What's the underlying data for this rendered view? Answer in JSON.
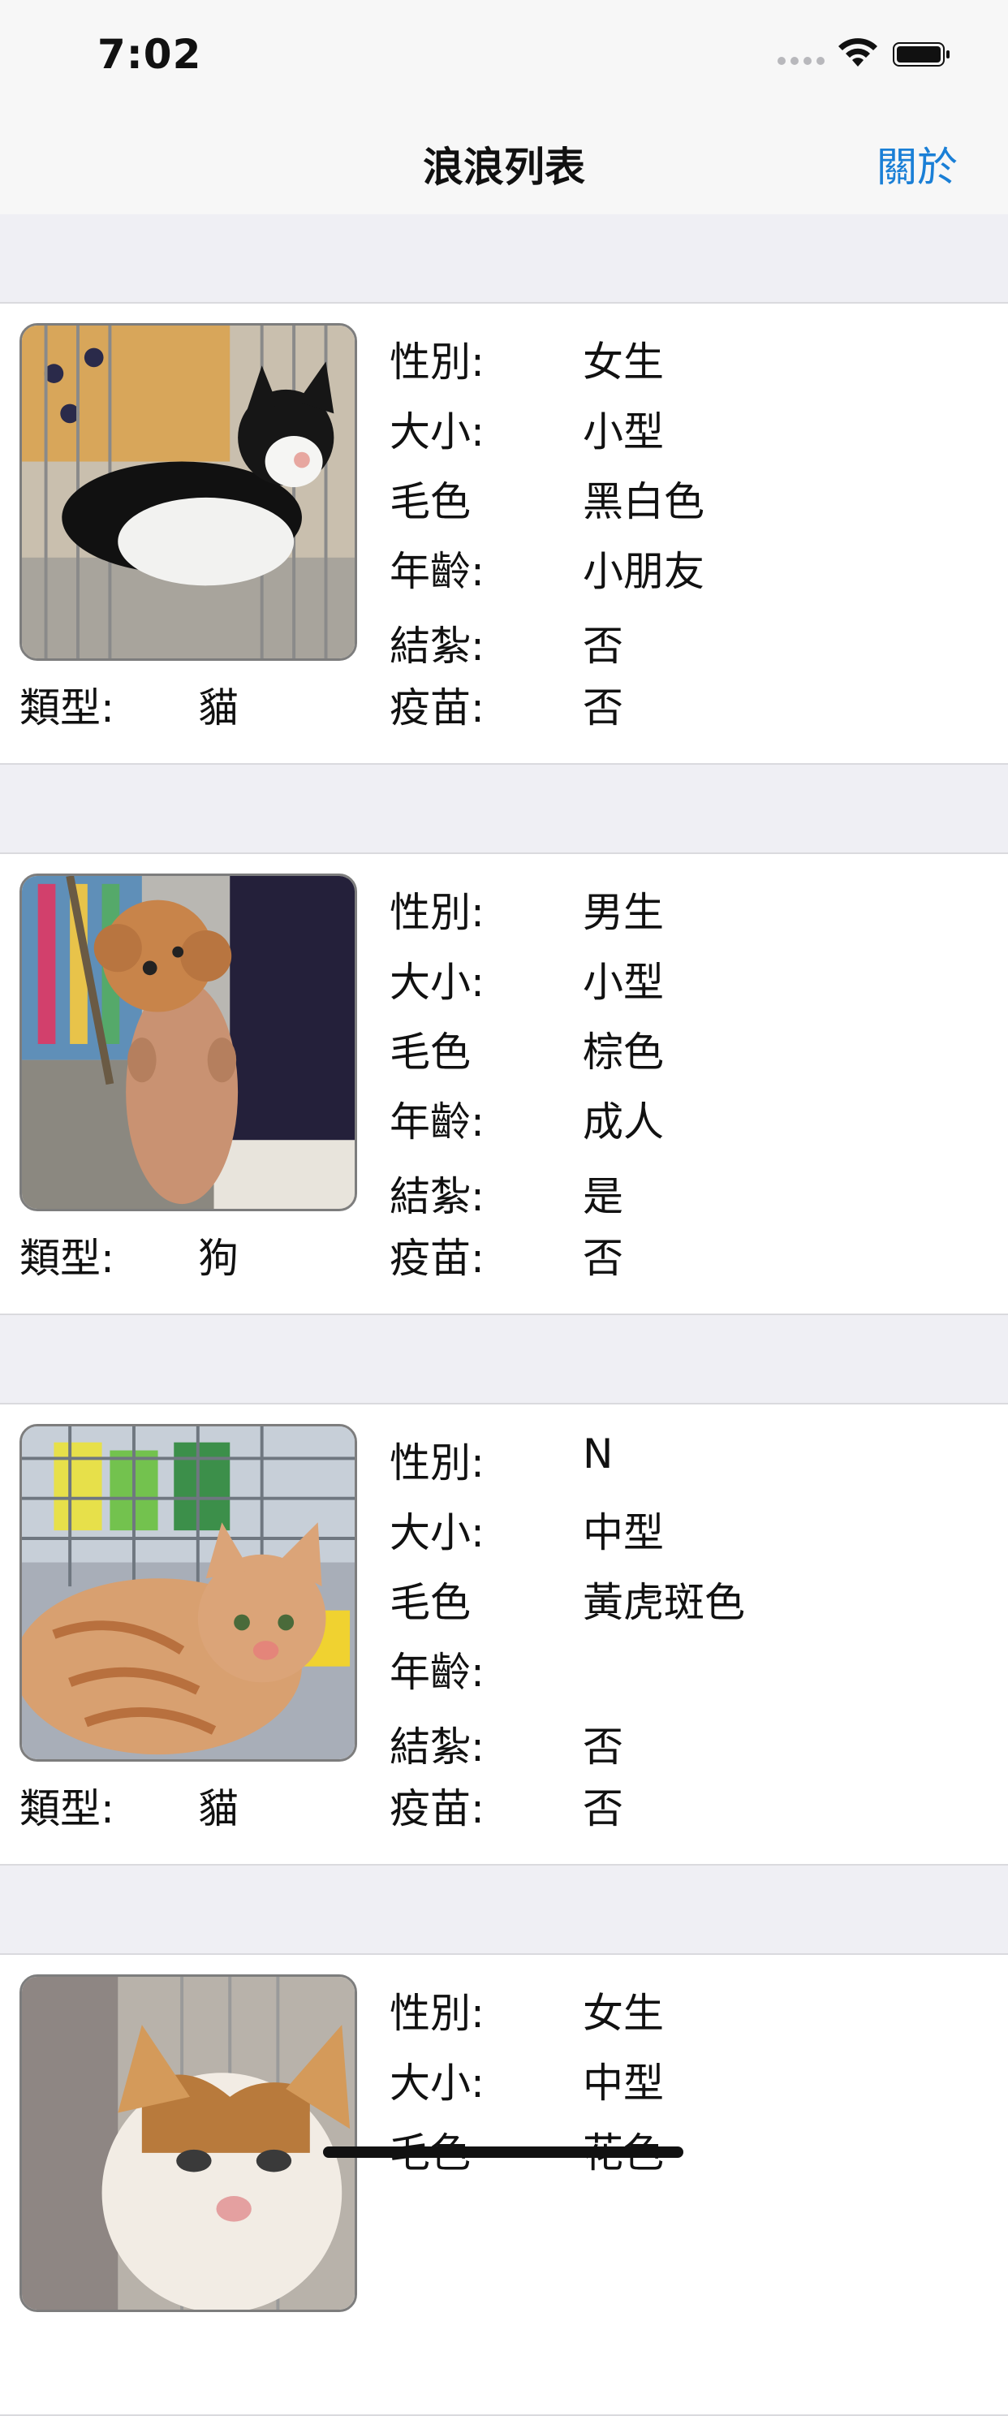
{
  "status_bar": {
    "time": "7:02"
  },
  "nav": {
    "title": "浪浪列表",
    "about_label": "關於"
  },
  "labels": {
    "gender": "性別:",
    "size": "大小:",
    "color": "毛色",
    "age": "年齡:",
    "neutered": "結紮:",
    "type": "類型:",
    "vaccine": "疫苗:"
  },
  "animals": [
    {
      "type": "貓",
      "gender": "女生",
      "size": "小型",
      "color": "黑白色",
      "age": "小朋友",
      "neutered": "否",
      "vaccine": "否"
    },
    {
      "type": "狗",
      "gender": "男生",
      "size": "小型",
      "color": "棕色",
      "age": "成人",
      "neutered": "是",
      "vaccine": "否"
    },
    {
      "type": "貓",
      "gender": "N",
      "size": "中型",
      "color": "黃虎斑色",
      "age": "",
      "neutered": "否",
      "vaccine": "否"
    },
    {
      "gender": "女生",
      "size": "中型",
      "color": "花色"
    }
  ]
}
